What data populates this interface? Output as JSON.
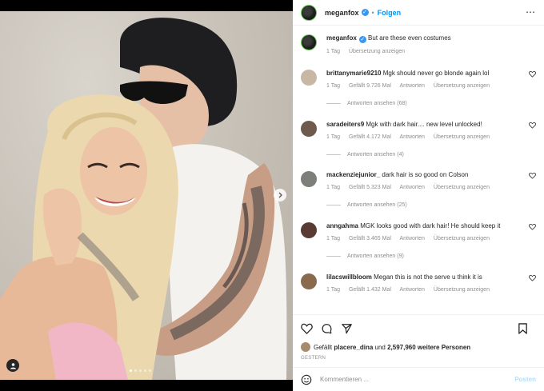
{
  "header": {
    "username": "meganfox",
    "separator": "•",
    "follow_label": "Folgen",
    "more_icon": "⋯"
  },
  "caption": {
    "username": "meganfox",
    "text": "But are these even costumes",
    "time": "1 Tag",
    "translate": "Übersetzung anzeigen"
  },
  "comments": [
    {
      "username": "brittanymarie9210",
      "text": "Mgk should never go blonde again lol",
      "time": "1 Tag",
      "likes": "Gefällt 9.726 Mal",
      "reply": "Antworten",
      "translate": "Übersetzung anzeigen",
      "view_replies": "Antworten ansehen (68)",
      "avatar_color": "#c9b7a6"
    },
    {
      "username": "saradeiters9",
      "text": "Mgk with dark hair.... new level unlocked!",
      "time": "1 Tag",
      "likes": "Gefällt 4.172 Mal",
      "reply": "Antworten",
      "translate": "Übersetzung anzeigen",
      "view_replies": "Antworten ansehen (4)",
      "avatar_color": "#6e5b4d"
    },
    {
      "username": "mackenziejunior_",
      "text": "dark hair is so good on Colson",
      "time": "1 Tag",
      "likes": "Gefällt 5.323 Mal",
      "reply": "Antworten",
      "translate": "Übersetzung anzeigen",
      "view_replies": "Antworten ansehen (25)",
      "avatar_color": "#7c7f7a"
    },
    {
      "username": "anngahma",
      "text": "MGK looks good with dark hair! He should keep it",
      "time": "1 Tag",
      "likes": "Gefällt 3.465 Mal",
      "reply": "Antworten",
      "translate": "Übersetzung anzeigen",
      "view_replies": "Antworten ansehen (9)",
      "avatar_color": "#5a3b33"
    },
    {
      "username": "lilacswillbloom",
      "text": "Megan this is not the serve u think it is",
      "time": "1 Tag",
      "likes": "Gefällt 1.432 Mal",
      "reply": "Antworten",
      "translate": "Übersetzung anzeigen",
      "view_replies": "",
      "avatar_color": "#8a6a4e"
    }
  ],
  "likes": {
    "prefix": "Gefällt",
    "user": "placere_dina",
    "conj": "und",
    "others": "2,597,960 weitere Personen"
  },
  "date_label": "GESTERN",
  "add_comment": {
    "placeholder": "Kommentieren ...",
    "post_label": "Posten"
  },
  "colors": {
    "accent": "#0095f6",
    "verified": "#3897f0",
    "story_ring": "#6bcf5a"
  }
}
